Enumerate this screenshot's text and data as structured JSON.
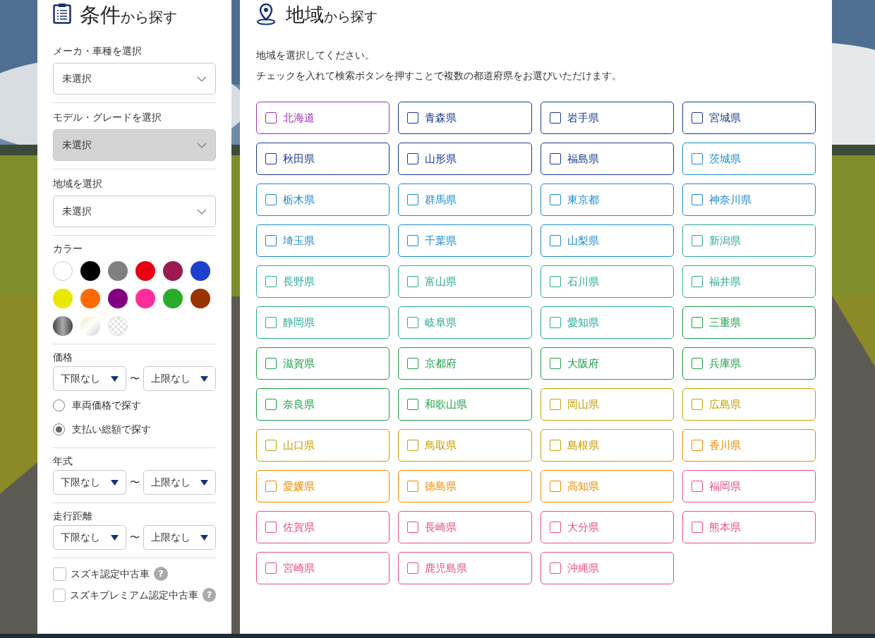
{
  "conditions_panel": {
    "title_main": "条件",
    "title_sub": "から探す",
    "maker_select": {
      "label": "メーカ・車種を選択",
      "value": "未選択",
      "disabled": false
    },
    "model_select": {
      "label": "モデル・グレードを選択",
      "value": "未選択",
      "disabled": true
    },
    "region_select": {
      "label": "地域を選択",
      "value": "未選択",
      "disabled": false
    },
    "color": {
      "label": "カラー",
      "swatches": [
        {
          "kind": "solid",
          "color": "#ffffff"
        },
        {
          "kind": "solid",
          "color": "#000000"
        },
        {
          "kind": "solid",
          "color": "#808080"
        },
        {
          "kind": "solid",
          "color": "#e60012"
        },
        {
          "kind": "solid",
          "color": "#9b1a4f"
        },
        {
          "kind": "solid",
          "color": "#1e3fcf"
        },
        {
          "kind": "solid",
          "color": "#ebe800"
        },
        {
          "kind": "solid",
          "color": "#ff6a00"
        },
        {
          "kind": "solid",
          "color": "#800080"
        },
        {
          "kind": "solid",
          "color": "#ff2e9a"
        },
        {
          "kind": "solid",
          "color": "#2aac28"
        },
        {
          "kind": "solid",
          "color": "#993300"
        },
        {
          "kind": "metallic"
        },
        {
          "kind": "pearl"
        },
        {
          "kind": "clear"
        }
      ]
    },
    "price": {
      "label": "価格",
      "min": "下限なし",
      "separator": "〜",
      "max": "上限なし",
      "options": [
        {
          "label": "車両価格で探す",
          "selected": false
        },
        {
          "label": "支払い総額で探す",
          "selected": true
        }
      ]
    },
    "year": {
      "label": "年式",
      "min": "下限なし",
      "separator": "〜",
      "max": "上限なし"
    },
    "mileage": {
      "label": "走行距離",
      "min": "下限なし",
      "separator": "〜",
      "max": "上限なし"
    },
    "certifications": [
      {
        "label": "スズキ認定中古車",
        "checked": false,
        "help": "?"
      },
      {
        "label": "スズキプレミアム認定中古車",
        "checked": false,
        "help": "?"
      }
    ]
  },
  "region_panel": {
    "title_main": "地域",
    "title_sub": "から探す",
    "instructions": [
      "地域を選択してください。",
      "チェックを入れて検索ボタンを押すことで複数の都道府県をお選びいただけます。"
    ],
    "prefectures": [
      {
        "name": "北海道",
        "checked": false,
        "color": "#9a35b5"
      },
      {
        "name": "青森県",
        "checked": false,
        "color": "#1a3a94"
      },
      {
        "name": "岩手県",
        "checked": false,
        "color": "#1a3a94"
      },
      {
        "name": "宮城県",
        "checked": false,
        "color": "#1a3a94"
      },
      {
        "name": "秋田県",
        "checked": false,
        "color": "#1a3a94"
      },
      {
        "name": "山形県",
        "checked": false,
        "color": "#1a3a94"
      },
      {
        "name": "福島県",
        "checked": false,
        "color": "#1a3a94"
      },
      {
        "name": "茨城県",
        "checked": false,
        "color": "#1a8ad0"
      },
      {
        "name": "栃木県",
        "checked": false,
        "color": "#1a8ad0"
      },
      {
        "name": "群馬県",
        "checked": false,
        "color": "#1a8ad0"
      },
      {
        "name": "東京都",
        "checked": false,
        "color": "#1a8ad0"
      },
      {
        "name": "神奈川県",
        "checked": false,
        "color": "#1a8ad0"
      },
      {
        "name": "埼玉県",
        "checked": false,
        "color": "#1a8ad0"
      },
      {
        "name": "千葉県",
        "checked": false,
        "color": "#1a8ad0"
      },
      {
        "name": "山梨県",
        "checked": false,
        "color": "#1a8ad0"
      },
      {
        "name": "新潟県",
        "checked": false,
        "color": "#2aaa9a"
      },
      {
        "name": "長野県",
        "checked": false,
        "color": "#2aaa9a"
      },
      {
        "name": "富山県",
        "checked": false,
        "color": "#2aaa9a"
      },
      {
        "name": "石川県",
        "checked": false,
        "color": "#2aaa9a"
      },
      {
        "name": "福井県",
        "checked": false,
        "color": "#2aaa9a"
      },
      {
        "name": "静岡県",
        "checked": false,
        "color": "#2aaa9a"
      },
      {
        "name": "岐阜県",
        "checked": false,
        "color": "#2aaa9a"
      },
      {
        "name": "愛知県",
        "checked": false,
        "color": "#2aaa9a"
      },
      {
        "name": "三重県",
        "checked": false,
        "color": "#1e9e48"
      },
      {
        "name": "滋賀県",
        "checked": false,
        "color": "#1e9e48"
      },
      {
        "name": "京都府",
        "checked": false,
        "color": "#1e9e48"
      },
      {
        "name": "大阪府",
        "checked": false,
        "color": "#1e9e48"
      },
      {
        "name": "兵庫県",
        "checked": false,
        "color": "#1e9e48"
      },
      {
        "name": "奈良県",
        "checked": false,
        "color": "#1e9e48"
      },
      {
        "name": "和歌山県",
        "checked": false,
        "color": "#1e9e48"
      },
      {
        "name": "岡山県",
        "checked": false,
        "color": "#c4a000"
      },
      {
        "name": "広島県",
        "checked": false,
        "color": "#c4a000"
      },
      {
        "name": "山口県",
        "checked": false,
        "color": "#c4a000"
      },
      {
        "name": "鳥取県",
        "checked": false,
        "color": "#c4a000"
      },
      {
        "name": "島根県",
        "checked": false,
        "color": "#c4a000"
      },
      {
        "name": "香川県",
        "checked": false,
        "color": "#ee8c00"
      },
      {
        "name": "愛媛県",
        "checked": false,
        "color": "#ee8c00"
      },
      {
        "name": "徳島県",
        "checked": false,
        "color": "#ee8c00"
      },
      {
        "name": "高知県",
        "checked": false,
        "color": "#ee8c00"
      },
      {
        "name": "福岡県",
        "checked": false,
        "color": "#e8507e"
      },
      {
        "name": "佐賀県",
        "checked": false,
        "color": "#e8507e"
      },
      {
        "name": "長崎県",
        "checked": false,
        "color": "#e8507e"
      },
      {
        "name": "大分県",
        "checked": false,
        "color": "#e8507e"
      },
      {
        "name": "熊本県",
        "checked": false,
        "color": "#e8507e"
      },
      {
        "name": "宮崎県",
        "checked": false,
        "color": "#e8507e"
      },
      {
        "name": "鹿児島県",
        "checked": false,
        "color": "#e8507e"
      },
      {
        "name": "沖縄県",
        "checked": false,
        "color": "#e8507e"
      }
    ]
  }
}
